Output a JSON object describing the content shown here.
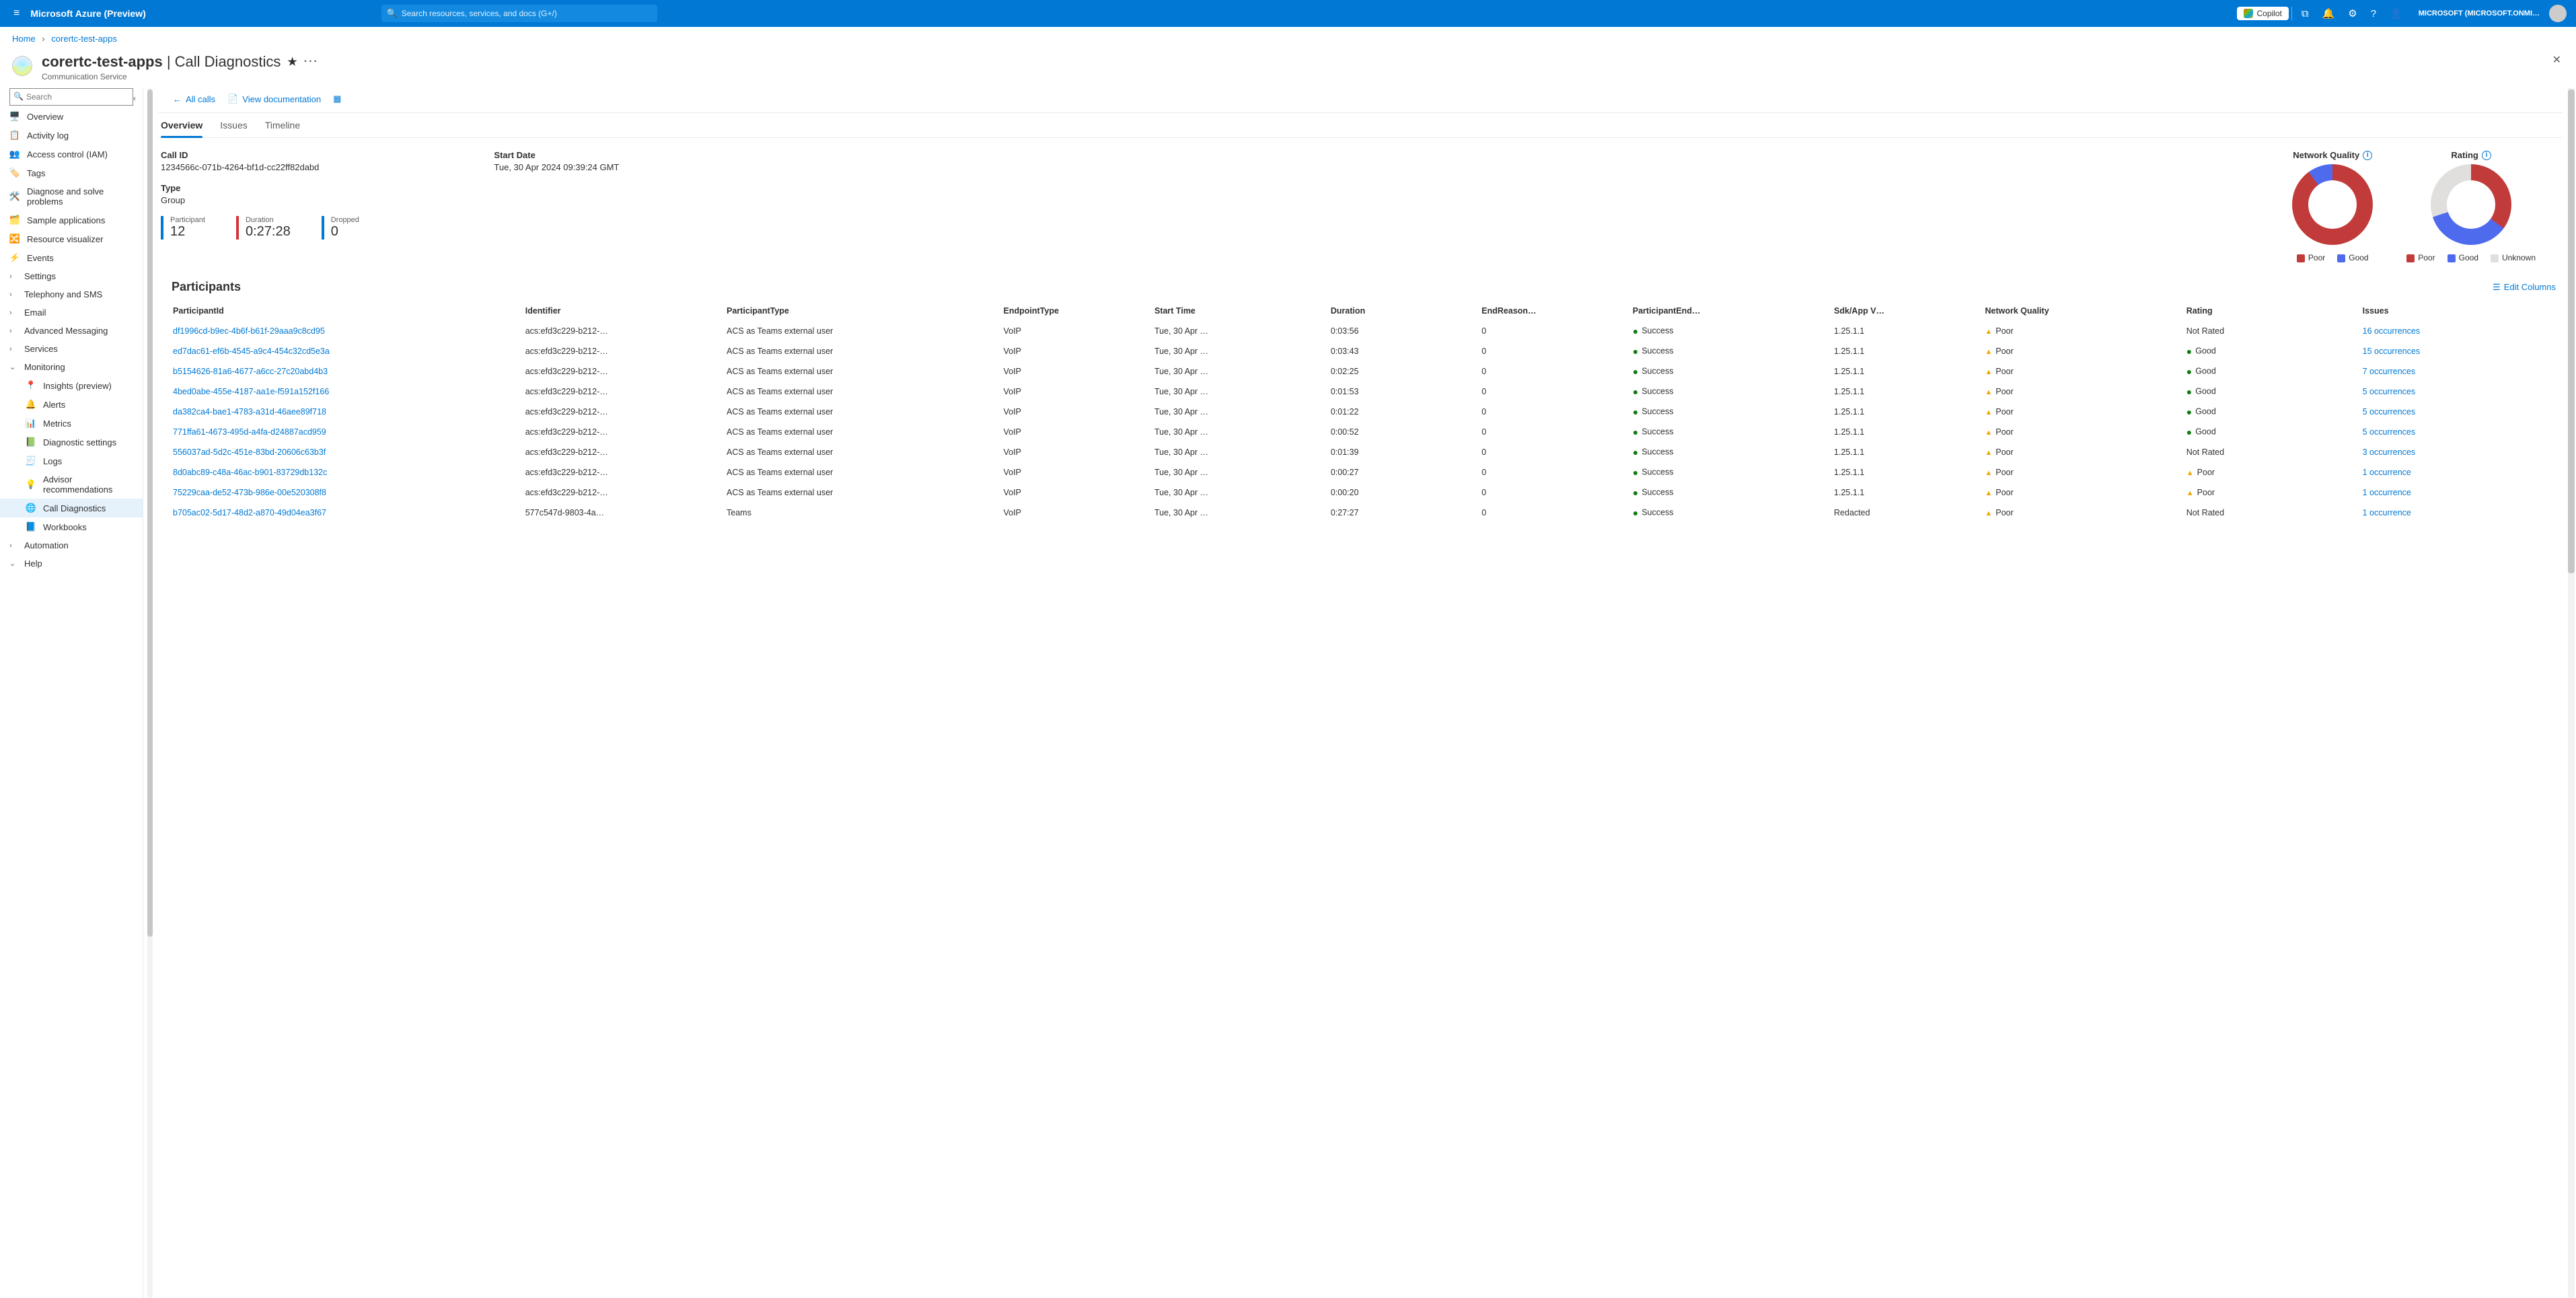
{
  "topbar": {
    "brand": "Microsoft Azure (Preview)",
    "search_placeholder": "Search resources, services, and docs (G+/)",
    "copilot": "Copilot",
    "account": "MICROSOFT (MICROSOFT.ONMI…"
  },
  "breadcrumb": {
    "home": "Home",
    "resource": "corertc-test-apps"
  },
  "page": {
    "title_prefix": "corertc-test-apps",
    "title_suffix": " | Call Diagnostics",
    "subtype": "Communication Service"
  },
  "sidebar": {
    "search_placeholder": "Search",
    "items": [
      {
        "label": "Overview",
        "icon": "🖥️",
        "cls": "ic-blue"
      },
      {
        "label": "Activity log",
        "icon": "📋",
        "cls": "ic-blue"
      },
      {
        "label": "Access control (IAM)",
        "icon": "👥",
        "cls": "ic-blue"
      },
      {
        "label": "Tags",
        "icon": "🏷️",
        "cls": "ic-purple"
      },
      {
        "label": "Diagnose and solve problems",
        "icon": "🛠️",
        "cls": "ic-blue"
      },
      {
        "label": "Sample applications",
        "icon": "🗂️",
        "cls": "ic-blue"
      },
      {
        "label": "Resource visualizer",
        "icon": "🔀",
        "cls": "ic-teal"
      },
      {
        "label": "Events",
        "icon": "⚡",
        "cls": "ic-yellow"
      },
      {
        "label": "Settings",
        "chev": ">"
      },
      {
        "label": "Telephony and SMS",
        "chev": ">"
      },
      {
        "label": "Email",
        "chev": ">"
      },
      {
        "label": "Advanced Messaging",
        "chev": ">"
      },
      {
        "label": "Services",
        "chev": ">"
      },
      {
        "label": "Monitoring",
        "chev": "v",
        "expanded": true
      },
      {
        "label": "Insights (preview)",
        "icon": "📍",
        "indent": true,
        "cls": "ic-purple"
      },
      {
        "label": "Alerts",
        "icon": "🔔",
        "indent": true,
        "cls": "ic-green"
      },
      {
        "label": "Metrics",
        "icon": "📊",
        "indent": true,
        "cls": "ic-blue"
      },
      {
        "label": "Diagnostic settings",
        "icon": "📗",
        "indent": true,
        "cls": "ic-green"
      },
      {
        "label": "Logs",
        "icon": "🧾",
        "indent": true,
        "cls": "ic-blue"
      },
      {
        "label": "Advisor recommendations",
        "icon": "💡",
        "indent": true,
        "cls": "ic-blue"
      },
      {
        "label": "Call Diagnostics",
        "icon": "🌐",
        "indent": true,
        "selected": true
      },
      {
        "label": "Workbooks",
        "icon": "📘",
        "indent": true,
        "cls": "ic-blue"
      },
      {
        "label": "Automation",
        "chev": ">"
      },
      {
        "label": "Help",
        "chev": "v"
      }
    ]
  },
  "toolbar": {
    "all_calls": "All calls",
    "view_docs": "View documentation"
  },
  "tabs": [
    "Overview",
    "Issues",
    "Timeline"
  ],
  "overview": {
    "call_id_label": "Call ID",
    "call_id": "1234566c-071b-4264-bf1d-cc22ff82dabd",
    "start_label": "Start Date",
    "start": "Tue, 30 Apr 2024 09:39:24 GMT",
    "type_label": "Type",
    "type": "Group",
    "metrics": [
      {
        "label": "Participant",
        "value": "12",
        "color": "blue"
      },
      {
        "label": "Duration",
        "value": "0:27:28",
        "color": "red"
      },
      {
        "label": "Dropped",
        "value": "0",
        "color": "blue"
      }
    ]
  },
  "chart_data": [
    {
      "type": "pie",
      "title": "Network Quality",
      "series": [
        {
          "name": "Poor",
          "value": 90,
          "color": "#c23b3b"
        },
        {
          "name": "Good",
          "value": 10,
          "color": "#4f6bed"
        }
      ],
      "legend": [
        "Poor",
        "Good"
      ]
    },
    {
      "type": "pie",
      "title": "Rating",
      "series": [
        {
          "name": "Poor",
          "value": 35,
          "color": "#c23b3b"
        },
        {
          "name": "Good",
          "value": 35,
          "color": "#4f6bed"
        },
        {
          "name": "Unknown",
          "value": 30,
          "color": "#e1dfdd"
        }
      ],
      "legend": [
        "Poor",
        "Good",
        "Unknown"
      ]
    }
  ],
  "participants": {
    "title": "Participants",
    "edit_columns": "Edit Columns",
    "columns": [
      "ParticipantId",
      "Identifier",
      "ParticipantType",
      "EndpointType",
      "Start Time",
      "Duration",
      "EndReason…",
      "ParticipantEnd…",
      "Sdk/App V…",
      "Network Quality",
      "Rating",
      "Issues"
    ],
    "rows": [
      {
        "pid": "df1996cd-b9ec-4b6f-b61f-29aaa9c8cd95",
        "ident": "acs:efd3c229-b212-…",
        "ptype": "ACS as Teams external user",
        "etype": "VoIP",
        "start": "Tue, 30 Apr …",
        "dur": "0:03:56",
        "end": "0",
        "pend": "Success",
        "sdk": "1.25.1.1",
        "nq": "Poor",
        "rate": "Not Rated",
        "rate_kind": "none",
        "iss": "16 occurrences"
      },
      {
        "pid": "ed7dac61-ef6b-4545-a9c4-454c32cd5e3a",
        "ident": "acs:efd3c229-b212-…",
        "ptype": "ACS as Teams external user",
        "etype": "VoIP",
        "start": "Tue, 30 Apr …",
        "dur": "0:03:43",
        "end": "0",
        "pend": "Success",
        "sdk": "1.25.1.1",
        "nq": "Poor",
        "rate": "Good",
        "rate_kind": "good",
        "iss": "15 occurrences"
      },
      {
        "pid": "b5154626-81a6-4677-a6cc-27c20abd4b3",
        "ident": "acs:efd3c229-b212-…",
        "ptype": "ACS as Teams external user",
        "etype": "VoIP",
        "start": "Tue, 30 Apr …",
        "dur": "0:02:25",
        "end": "0",
        "pend": "Success",
        "sdk": "1.25.1.1",
        "nq": "Poor",
        "rate": "Good",
        "rate_kind": "good",
        "iss": "7 occurrences"
      },
      {
        "pid": "4bed0abe-455e-4187-aa1e-f591a152f166",
        "ident": "acs:efd3c229-b212-…",
        "ptype": "ACS as Teams external user",
        "etype": "VoIP",
        "start": "Tue, 30 Apr …",
        "dur": "0:01:53",
        "end": "0",
        "pend": "Success",
        "sdk": "1.25.1.1",
        "nq": "Poor",
        "rate": "Good",
        "rate_kind": "good",
        "iss": "5 occurrences"
      },
      {
        "pid": "da382ca4-bae1-4783-a31d-46aee89f718",
        "ident": "acs:efd3c229-b212-…",
        "ptype": "ACS as Teams external user",
        "etype": "VoIP",
        "start": "Tue, 30 Apr …",
        "dur": "0:01:22",
        "end": "0",
        "pend": "Success",
        "sdk": "1.25.1.1",
        "nq": "Poor",
        "rate": "Good",
        "rate_kind": "good",
        "iss": "5 occurrences"
      },
      {
        "pid": "771ffa61-4673-495d-a4fa-d24887acd959",
        "ident": "acs:efd3c229-b212-…",
        "ptype": "ACS as Teams external user",
        "etype": "VoIP",
        "start": "Tue, 30 Apr …",
        "dur": "0:00:52",
        "end": "0",
        "pend": "Success",
        "sdk": "1.25.1.1",
        "nq": "Poor",
        "rate": "Good",
        "rate_kind": "good",
        "iss": "5 occurrences"
      },
      {
        "pid": "556037ad-5d2c-451e-83bd-20606c63b3f",
        "ident": "acs:efd3c229-b212-…",
        "ptype": "ACS as Teams external user",
        "etype": "VoIP",
        "start": "Tue, 30 Apr …",
        "dur": "0:01:39",
        "end": "0",
        "pend": "Success",
        "sdk": "1.25.1.1",
        "nq": "Poor",
        "rate": "Not Rated",
        "rate_kind": "none",
        "iss": "3 occurrences"
      },
      {
        "pid": "8d0abc89-c48a-46ac-b901-83729db132c",
        "ident": "acs:efd3c229-b212-…",
        "ptype": "ACS as Teams external user",
        "etype": "VoIP",
        "start": "Tue, 30 Apr …",
        "dur": "0:00:27",
        "end": "0",
        "pend": "Success",
        "sdk": "1.25.1.1",
        "nq": "Poor",
        "rate": "Poor",
        "rate_kind": "warn",
        "iss": "1 occurrence"
      },
      {
        "pid": "75229caa-de52-473b-986e-00e520308f8",
        "ident": "acs:efd3c229-b212-…",
        "ptype": "ACS as Teams external user",
        "etype": "VoIP",
        "start": "Tue, 30 Apr …",
        "dur": "0:00:20",
        "end": "0",
        "pend": "Success",
        "sdk": "1.25.1.1",
        "nq": "Poor",
        "rate": "Poor",
        "rate_kind": "warn",
        "iss": "1 occurrence"
      },
      {
        "pid": "b705ac02-5d17-48d2-a870-49d04ea3f67",
        "ident": "577c547d-9803-4a…",
        "ptype": "Teams",
        "etype": "VoIP",
        "start": "Tue, 30 Apr …",
        "dur": "0:27:27",
        "end": "0",
        "pend": "Success",
        "sdk": "Redacted",
        "nq": "Poor",
        "rate": "Not Rated",
        "rate_kind": "none",
        "iss": "1 occurrence"
      }
    ]
  }
}
